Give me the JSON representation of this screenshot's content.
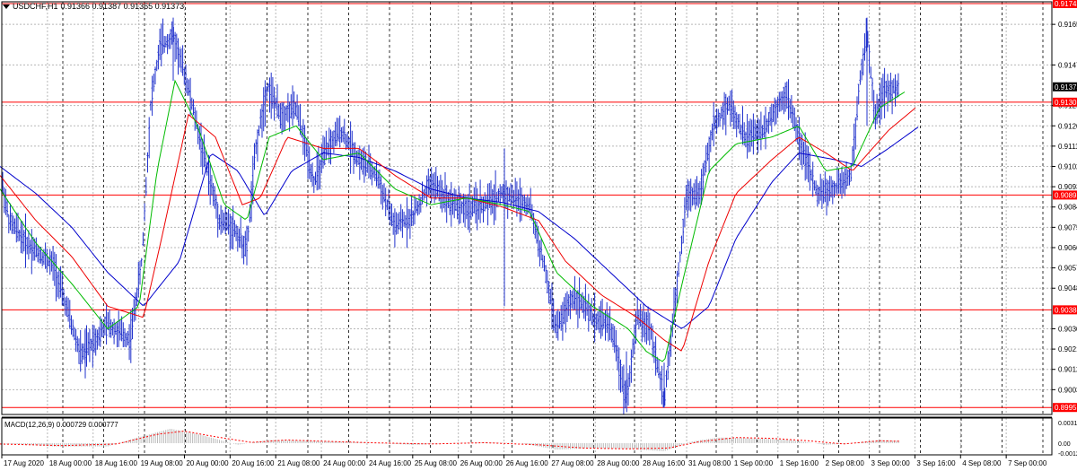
{
  "header": {
    "symbol": "USDCHF,H1",
    "ohlc": "0.91366 0.91387 0.91365 0.91373"
  },
  "macd_label": "MACD(12,26,9) 0.000729 0.000777",
  "price_axis": {
    "min": 0.8992,
    "max": 0.9175,
    "labels": [
      "0.91650",
      "0.91470",
      "0.91290",
      "0.91200",
      "0.91110",
      "0.91020",
      "0.90930",
      "0.90840",
      "0.90750",
      "0.90660",
      "0.90570",
      "0.90480",
      "0.90300",
      "0.90210",
      "0.90120",
      "0.90030"
    ],
    "current_price": "0.91373",
    "hlines": [
      "0.91742",
      "0.91305",
      "0.90893",
      "0.90384",
      "0.89951"
    ]
  },
  "macd_axis": {
    "labels": [
      "0.003111",
      "0.00",
      "-0.001234"
    ]
  },
  "time_axis": {
    "labels": [
      "17 Aug 2020",
      "18 Aug 00:00",
      "18 Aug 16:00",
      "19 Aug 08:00",
      "20 Aug 00:00",
      "20 Aug 16:00",
      "21 Aug 08:00",
      "24 Aug 00:00",
      "24 Aug 16:00",
      "25 Aug 08:00",
      "26 Aug 00:00",
      "26 Aug 16:00",
      "27 Aug 08:00",
      "28 Aug 00:00",
      "28 Aug 16:00",
      "31 Aug 08:00",
      "1 Sep 00:00",
      "1 Sep 16:00",
      "2 Sep 08:00",
      "3 Sep 00:00",
      "3 Sep 16:00",
      "4 Sep 08:00",
      "7 Sep 00:00"
    ]
  },
  "colors": {
    "bars": "#2233cc",
    "ma_fast": "#00bb00",
    "ma_mid": "#ee0000",
    "ma_slow": "#0000cc",
    "hline": "#ff0000",
    "grid": "#b8b8b8",
    "macd_hist": "#bbbbbb",
    "macd_signal": "#ff0000"
  },
  "chart_data": {
    "type": "line",
    "series_shape": "ohlc-bars",
    "keypoints_price": [
      [
        0,
        0.91
      ],
      [
        10,
        0.9078
      ],
      [
        30,
        0.9068
      ],
      [
        60,
        0.9058
      ],
      [
        90,
        0.9018
      ],
      [
        120,
        0.9032
      ],
      [
        145,
        0.9025
      ],
      [
        158,
        0.906
      ],
      [
        168,
        0.913
      ],
      [
        178,
        0.9155
      ],
      [
        193,
        0.916
      ],
      [
        208,
        0.914
      ],
      [
        225,
        0.911
      ],
      [
        245,
        0.9078
      ],
      [
        260,
        0.9075
      ],
      [
        275,
        0.9065
      ],
      [
        285,
        0.911
      ],
      [
        298,
        0.9138
      ],
      [
        312,
        0.9125
      ],
      [
        330,
        0.9128
      ],
      [
        350,
        0.9095
      ],
      [
        365,
        0.911
      ],
      [
        380,
        0.9118
      ],
      [
        400,
        0.9105
      ],
      [
        420,
        0.9098
      ],
      [
        440,
        0.9075
      ],
      [
        460,
        0.908
      ],
      [
        480,
        0.9095
      ],
      [
        500,
        0.9087
      ],
      [
        520,
        0.9083
      ],
      [
        540,
        0.9085
      ],
      [
        560,
        0.909
      ],
      [
        575,
        0.9088
      ],
      [
        590,
        0.9085
      ],
      [
        605,
        0.906
      ],
      [
        620,
        0.903
      ],
      [
        640,
        0.9045
      ],
      [
        660,
        0.9035
      ],
      [
        680,
        0.9032
      ],
      [
        698,
        0.8999
      ],
      [
        710,
        0.9035
      ],
      [
        725,
        0.903
      ],
      [
        740,
        0.8998
      ],
      [
        752,
        0.904
      ],
      [
        765,
        0.909
      ],
      [
        780,
        0.909
      ],
      [
        795,
        0.912
      ],
      [
        812,
        0.913
      ],
      [
        830,
        0.9115
      ],
      [
        850,
        0.9118
      ],
      [
        875,
        0.9135
      ],
      [
        890,
        0.9115
      ],
      [
        910,
        0.909
      ],
      [
        930,
        0.9092
      ],
      [
        948,
        0.9098
      ],
      [
        958,
        0.914
      ],
      [
        966,
        0.916
      ],
      [
        975,
        0.9125
      ],
      [
        985,
        0.9135
      ],
      [
        1000,
        0.9137
      ]
    ],
    "ma_fast_keypoints": [
      [
        0,
        0.9092
      ],
      [
        40,
        0.9068
      ],
      [
        80,
        0.905
      ],
      [
        120,
        0.903
      ],
      [
        155,
        0.904
      ],
      [
        175,
        0.91
      ],
      [
        195,
        0.914
      ],
      [
        220,
        0.912
      ],
      [
        250,
        0.9085
      ],
      [
        275,
        0.9078
      ],
      [
        300,
        0.9115
      ],
      [
        330,
        0.912
      ],
      [
        360,
        0.9105
      ],
      [
        400,
        0.9108
      ],
      [
        440,
        0.9092
      ],
      [
        480,
        0.9085
      ],
      [
        520,
        0.9088
      ],
      [
        560,
        0.9085
      ],
      [
        590,
        0.9082
      ],
      [
        620,
        0.9055
      ],
      [
        660,
        0.904
      ],
      [
        700,
        0.903
      ],
      [
        720,
        0.902
      ],
      [
        740,
        0.9015
      ],
      [
        760,
        0.905
      ],
      [
        790,
        0.91
      ],
      [
        820,
        0.9112
      ],
      [
        860,
        0.9115
      ],
      [
        890,
        0.912
      ],
      [
        920,
        0.91
      ],
      [
        950,
        0.9102
      ],
      [
        980,
        0.9128
      ],
      [
        1008,
        0.9135
      ]
    ],
    "ma_mid_keypoints": [
      [
        0,
        0.9098
      ],
      [
        40,
        0.9078
      ],
      [
        80,
        0.9062
      ],
      [
        120,
        0.904
      ],
      [
        160,
        0.9035
      ],
      [
        180,
        0.907
      ],
      [
        210,
        0.9125
      ],
      [
        240,
        0.9115
      ],
      [
        270,
        0.9085
      ],
      [
        290,
        0.9088
      ],
      [
        320,
        0.9115
      ],
      [
        360,
        0.911
      ],
      [
        400,
        0.911
      ],
      [
        440,
        0.9098
      ],
      [
        480,
        0.9088
      ],
      [
        520,
        0.9088
      ],
      [
        560,
        0.9084
      ],
      [
        600,
        0.9078
      ],
      [
        630,
        0.906
      ],
      [
        670,
        0.9045
      ],
      [
        710,
        0.9035
      ],
      [
        740,
        0.9025
      ],
      [
        760,
        0.902
      ],
      [
        790,
        0.906
      ],
      [
        820,
        0.909
      ],
      [
        860,
        0.9105
      ],
      [
        890,
        0.9115
      ],
      [
        920,
        0.9108
      ],
      [
        950,
        0.91
      ],
      [
        990,
        0.9118
      ],
      [
        1020,
        0.9128
      ]
    ],
    "ma_slow_keypoints": [
      [
        0,
        0.9102
      ],
      [
        40,
        0.909
      ],
      [
        80,
        0.9075
      ],
      [
        120,
        0.9055
      ],
      [
        160,
        0.904
      ],
      [
        200,
        0.906
      ],
      [
        235,
        0.9108
      ],
      [
        265,
        0.91
      ],
      [
        295,
        0.908
      ],
      [
        325,
        0.91
      ],
      [
        360,
        0.9108
      ],
      [
        400,
        0.9106
      ],
      [
        440,
        0.91
      ],
      [
        480,
        0.9092
      ],
      [
        520,
        0.9088
      ],
      [
        560,
        0.9086
      ],
      [
        600,
        0.9082
      ],
      [
        640,
        0.907
      ],
      [
        680,
        0.9055
      ],
      [
        720,
        0.904
      ],
      [
        760,
        0.903
      ],
      [
        790,
        0.904
      ],
      [
        820,
        0.907
      ],
      [
        860,
        0.9095
      ],
      [
        890,
        0.9108
      ],
      [
        930,
        0.9105
      ],
      [
        960,
        0.9102
      ],
      [
        990,
        0.911
      ],
      [
        1025,
        0.912
      ]
    ],
    "macd_hist_keypoints": [
      [
        0,
        0.0
      ],
      [
        60,
        -0.2
      ],
      [
        120,
        -0.2
      ],
      [
        150,
        0.3
      ],
      [
        190,
        0.9
      ],
      [
        225,
        0.5
      ],
      [
        265,
        -0.1
      ],
      [
        300,
        0.2
      ],
      [
        340,
        0.15
      ],
      [
        380,
        0.1
      ],
      [
        420,
        0.0
      ],
      [
        460,
        -0.1
      ],
      [
        500,
        0.0
      ],
      [
        540,
        0.05
      ],
      [
        580,
        0.0
      ],
      [
        620,
        -0.4
      ],
      [
        660,
        -0.3
      ],
      [
        700,
        -0.35
      ],
      [
        740,
        -0.5
      ],
      [
        770,
        0.1
      ],
      [
        800,
        0.35
      ],
      [
        840,
        0.3
      ],
      [
        880,
        0.2
      ],
      [
        920,
        -0.1
      ],
      [
        950,
        0.0
      ],
      [
        980,
        0.2
      ],
      [
        1002,
        0.15
      ]
    ],
    "macd_signal_keypoints": [
      [
        0,
        -0.05
      ],
      [
        70,
        -0.15
      ],
      [
        130,
        -0.05
      ],
      [
        175,
        0.55
      ],
      [
        205,
        0.75
      ],
      [
        240,
        0.4
      ],
      [
        280,
        0.05
      ],
      [
        320,
        0.2
      ],
      [
        360,
        0.12
      ],
      [
        420,
        0.02
      ],
      [
        480,
        -0.05
      ],
      [
        540,
        0.03
      ],
      [
        600,
        -0.1
      ],
      [
        650,
        -0.3
      ],
      [
        700,
        -0.35
      ],
      [
        745,
        -0.3
      ],
      [
        780,
        0.1
      ],
      [
        820,
        0.35
      ],
      [
        860,
        0.3
      ],
      [
        900,
        0.15
      ],
      [
        940,
        -0.05
      ],
      [
        980,
        0.15
      ],
      [
        1002,
        0.12
      ]
    ]
  }
}
